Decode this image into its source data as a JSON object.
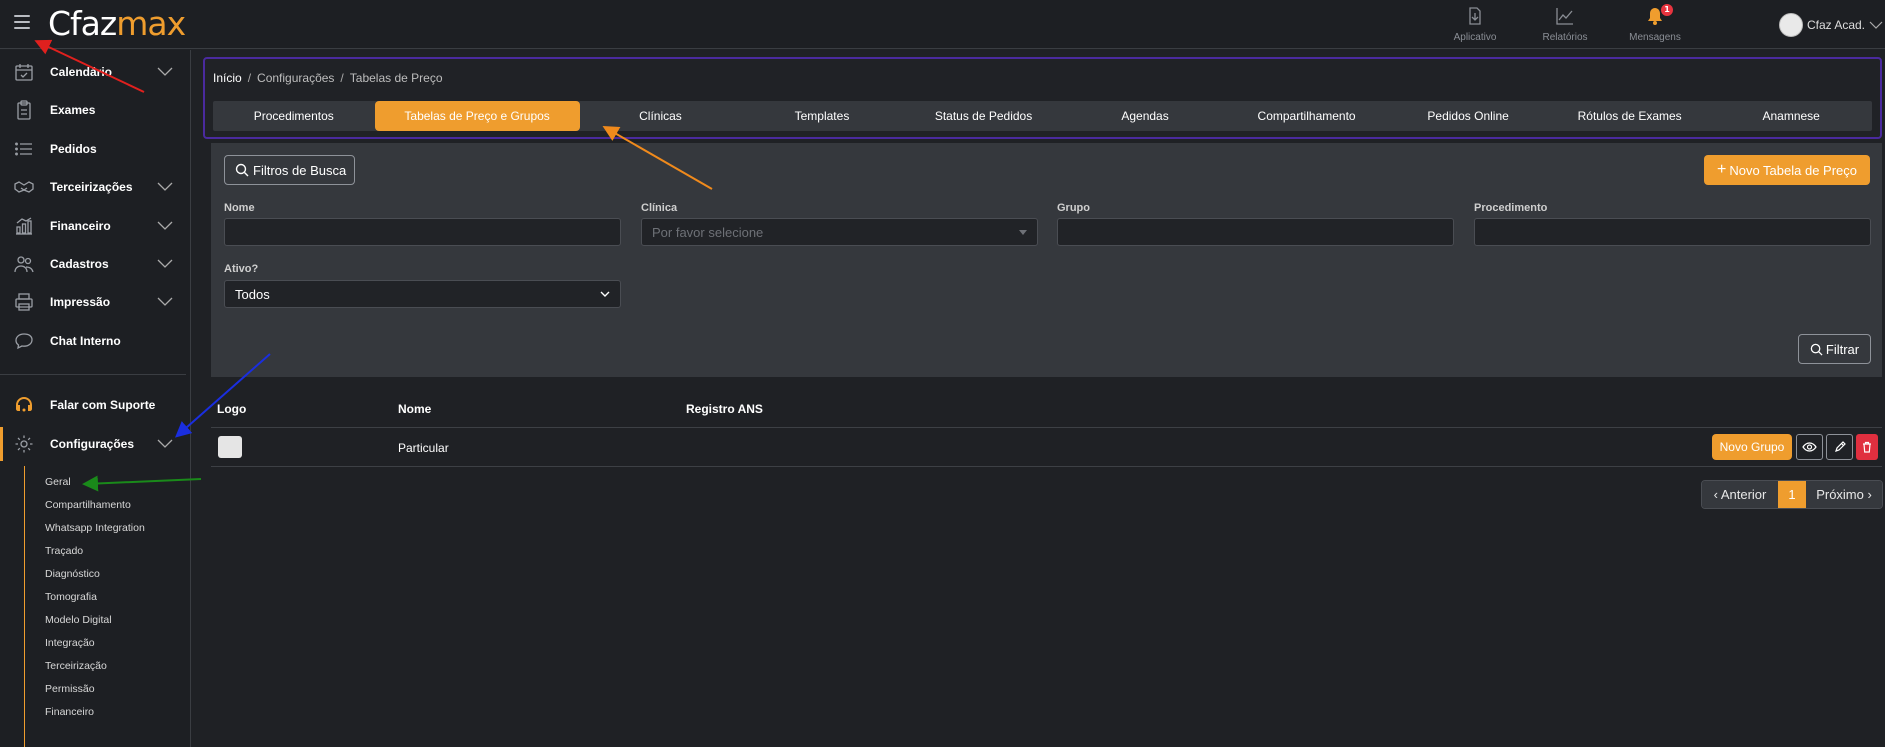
{
  "brand": {
    "part1": "Cfaz",
    "part2": "max",
    "orange": "#ef9d2e"
  },
  "topnav": [
    {
      "label": "Aplicativo",
      "icon": "download-icon"
    },
    {
      "label": "Relatórios",
      "icon": "chart-line-icon"
    },
    {
      "label": "Mensagens",
      "icon": "bell-icon",
      "badge": "1"
    }
  ],
  "user": {
    "name": "Cfaz Acad."
  },
  "sidebar": {
    "items": [
      {
        "label": "Calendário",
        "icon": "calendar-check-icon",
        "expandable": true
      },
      {
        "label": "Exames",
        "icon": "clipboard-icon",
        "expandable": false
      },
      {
        "label": "Pedidos",
        "icon": "list-icon",
        "expandable": false
      },
      {
        "label": "Terceirizações",
        "icon": "handshake-icon",
        "expandable": true
      },
      {
        "label": "Financeiro",
        "icon": "finance-icon",
        "expandable": true
      },
      {
        "label": "Cadastros",
        "icon": "users-icon",
        "expandable": true
      },
      {
        "label": "Impressão",
        "icon": "printer-icon",
        "expandable": true
      },
      {
        "label": "Chat Interno",
        "icon": "chat-icon",
        "expandable": false
      }
    ],
    "support": {
      "label": "Falar com Suporte",
      "icon": "headset-icon"
    },
    "config": {
      "label": "Configurações",
      "icon": "gear-icon"
    },
    "config_sub": [
      "Geral",
      "Compartilhamento",
      "Whatsapp Integration",
      "Traçado",
      "Diagnóstico",
      "Tomografia",
      "Modelo Digital",
      "Integração",
      "Terceirização",
      "Permissão",
      "Financeiro"
    ]
  },
  "breadcrumb": {
    "home": "Início",
    "mid": "Configurações",
    "current": "Tabelas de Preço",
    "separator": "/"
  },
  "tabs": [
    "Procedimentos",
    "Tabelas de Preço e Grupos",
    "Clínicas",
    "Templates",
    "Status de Pedidos",
    "Agendas",
    "Compartilhamento",
    "Pedidos Online",
    "Rótulos de Exames",
    "Anamnese"
  ],
  "active_tab": 1,
  "filters": {
    "toggle_label": "Filtros de Busca",
    "new_button": "Novo Tabela de Preço",
    "nome": {
      "label": "Nome",
      "value": ""
    },
    "clinica": {
      "label": "Clínica",
      "placeholder": "Por favor selecione"
    },
    "grupo": {
      "label": "Grupo",
      "value": ""
    },
    "procedimento": {
      "label": "Procedimento",
      "value": ""
    },
    "ativo": {
      "label": "Ativo?",
      "value": "Todos"
    },
    "filter_button": "Filtrar"
  },
  "table": {
    "headers": [
      "Logo",
      "Nome",
      "Registro ANS"
    ],
    "rows": [
      {
        "nome": "Particular",
        "registro_ans": "",
        "actions": {
          "new_group": "Novo Grupo"
        }
      }
    ]
  },
  "pagination": {
    "prev": "‹ Anterior",
    "current": "1",
    "next": "Próximo ›"
  },
  "colors": {
    "accent": "#ef9d2e",
    "danger": "#e02f3f",
    "frame": "#4a2a9e",
    "panel": "#35383d",
    "background": "#1f2125"
  }
}
